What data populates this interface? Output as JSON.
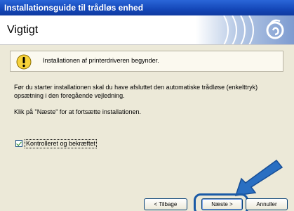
{
  "window": {
    "title": "Installationsguide til trådløs enhed"
  },
  "header": {
    "title": "Vigtigt"
  },
  "warning": {
    "icon": "warning-icon",
    "text": "Installationen af printerdriveren begynder."
  },
  "body": {
    "paragraph1": "Før du starter installationen skal du have afsluttet den automatiske trådløse (enkelttryk) opsætning i den foregående vejledning.",
    "paragraph2": "Klik på \"Næste\" for at fortsætte installationen."
  },
  "checkbox": {
    "label": "Kontrolleret og bekræftet",
    "checked": true
  },
  "buttons": {
    "back": "< Tilbage",
    "next": "Næste >",
    "cancel": "Annuller"
  },
  "colors": {
    "titlebar": "#1447b8",
    "dialog_bg": "#ece9d8",
    "annotation_blue": "#1a5aa6"
  }
}
